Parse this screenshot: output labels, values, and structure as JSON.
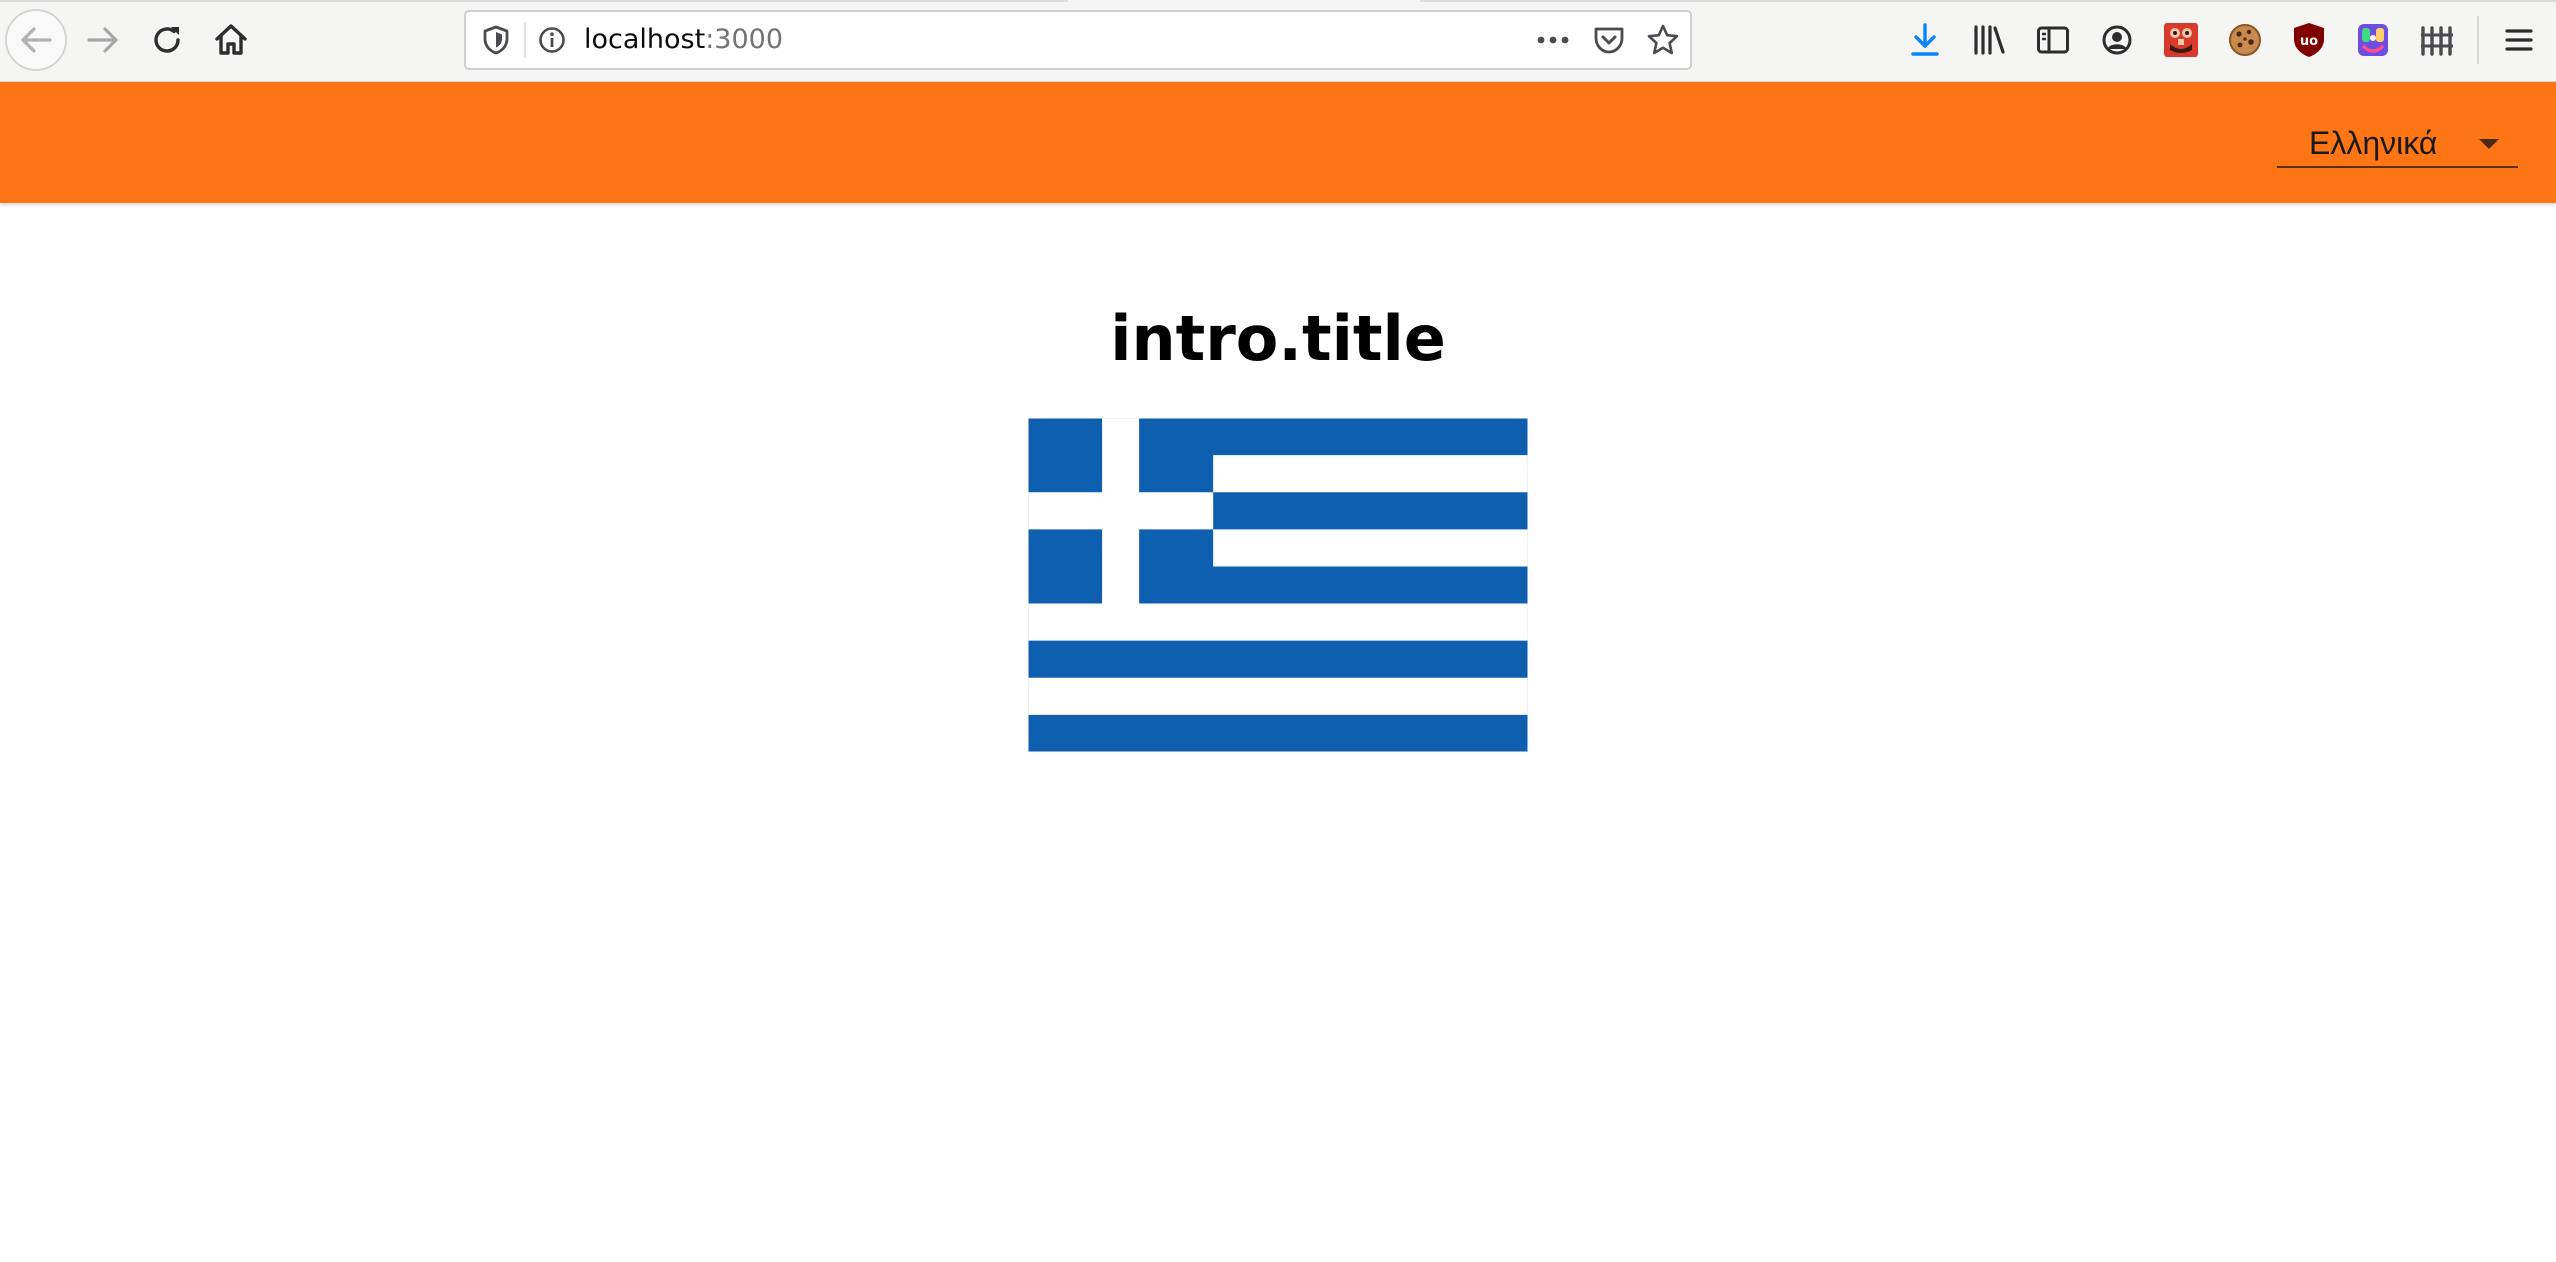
{
  "browser": {
    "url_host": "localhost",
    "url_port": ":3000",
    "icons": {
      "back": "back-arrow-icon",
      "forward": "forward-arrow-icon",
      "reload": "reload-icon",
      "home": "home-icon",
      "tracking": "tracking-protection-shield-icon",
      "info": "site-info-icon",
      "page_actions": "more-dots-icon",
      "pocket": "pocket-icon",
      "bookmark": "bookmark-star-icon",
      "downloads": "download-arrow-icon",
      "library": "library-icon",
      "sidebar": "sidebar-icon",
      "account": "account-icon",
      "extension_1": "extension-red-icon",
      "extension_cookie": "cookie-icon",
      "extension_ublock": "ublock-origin-icon",
      "extension_colorful": "colorful-extension-icon",
      "extension_fence": "fence-icon",
      "menu": "hamburger-menu-icon"
    },
    "accent_color": "#0a84ff"
  },
  "header": {
    "background_color": "#fe7516",
    "language_select": {
      "value": "Ελληνικά"
    }
  },
  "main": {
    "title": "intro.title",
    "flag": {
      "name": "greek-flag-icon",
      "blue": "#0f5fb0",
      "white": "#ffffff"
    }
  }
}
